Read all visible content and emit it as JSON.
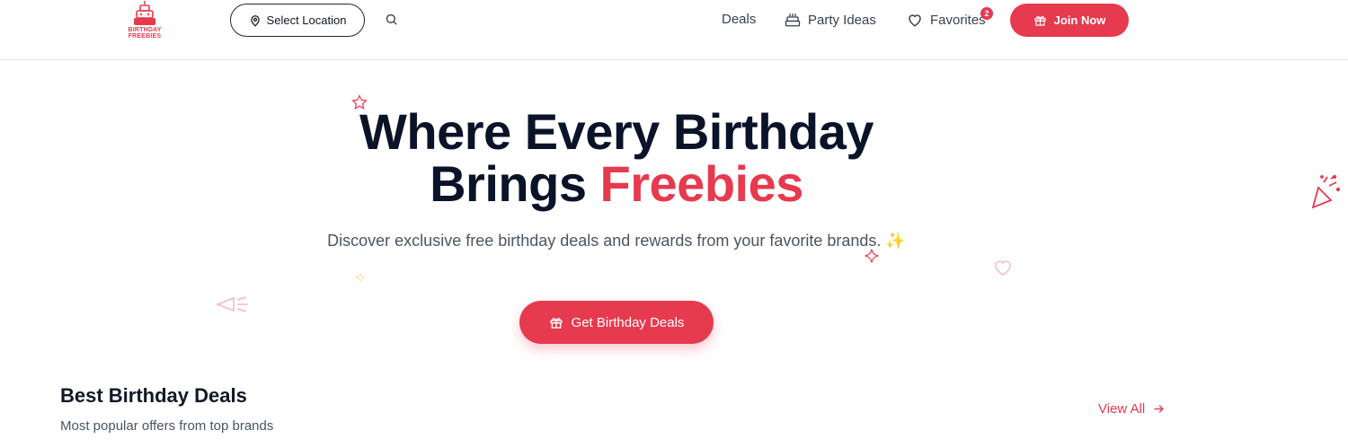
{
  "brand": {
    "logo_line1": "BIRTHDAY",
    "logo_line2": "FREEBIES",
    "accent": "#e63a4f"
  },
  "header": {
    "location_label": "Select Location",
    "nav": {
      "deals": "Deals",
      "party_ideas": "Party Ideas",
      "favorites": "Favorites",
      "favorites_count": "2"
    },
    "join_label": "Join Now"
  },
  "hero": {
    "title_line1": "Where Every Birthday",
    "title_line2_plain": "Brings ",
    "title_line2_accent": "Freebies",
    "subtitle": "Discover exclusive free birthday deals and rewards from your favorite brands. ✨",
    "cta_label": "Get Birthday Deals"
  },
  "section": {
    "title": "Best Birthday Deals",
    "subtitle": "Most popular offers from top brands",
    "view_all": "View All"
  },
  "icons": [
    "cake-logo-icon",
    "location-pin-icon",
    "search-icon",
    "cake-icon",
    "heart-icon",
    "gift-icon",
    "arrow-right-icon",
    "star-icon",
    "party-popper-icon",
    "sparkle-icon",
    "megaphone-icon"
  ]
}
